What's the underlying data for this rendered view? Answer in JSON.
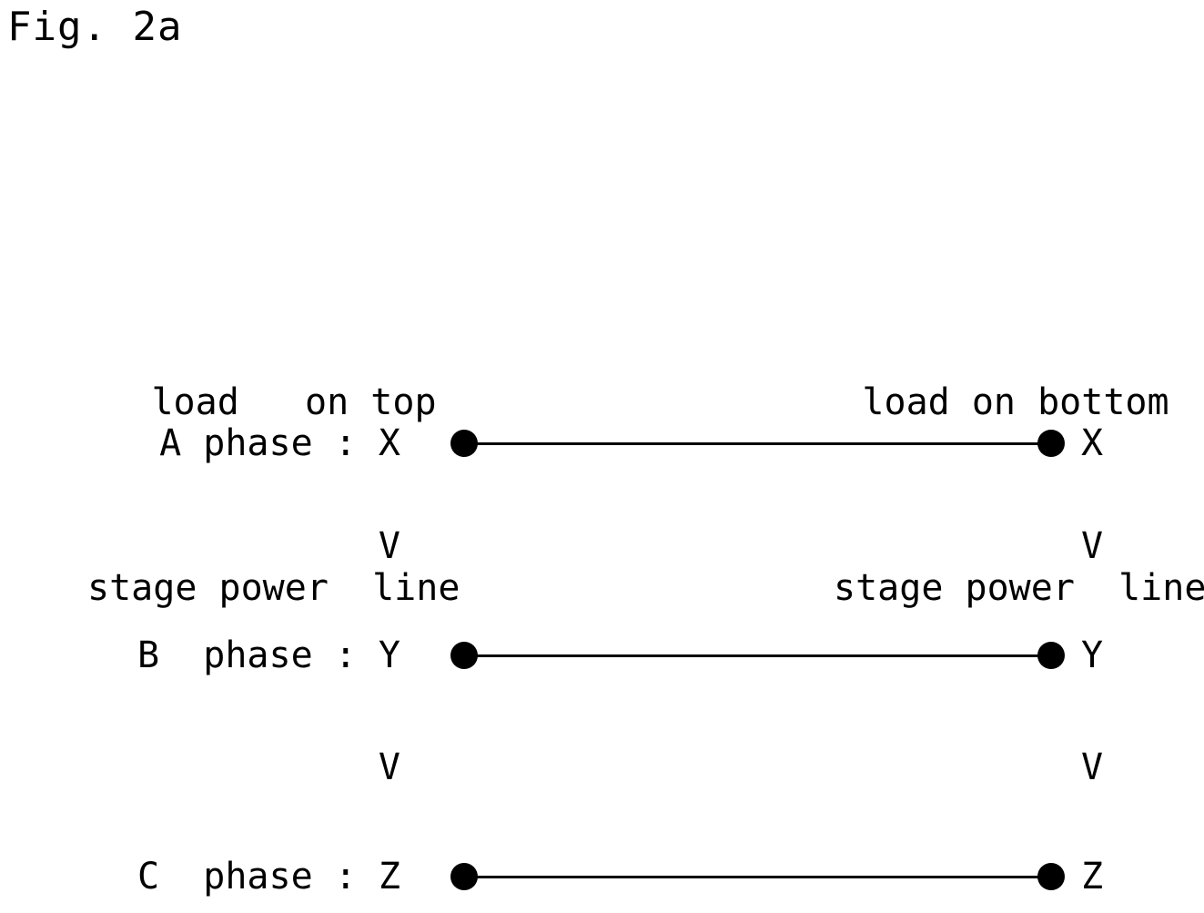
{
  "figure": {
    "caption": "Fig. 2a"
  },
  "headers": {
    "left": {
      "line1": "load   on top",
      "line2": "stage power  line"
    },
    "right": {
      "line1": "load on bottom",
      "line2": "stage power  line"
    }
  },
  "separator": {
    "mark": "V"
  },
  "rows": [
    {
      "label": "A phase :",
      "left_terminal": "X",
      "right_terminal": "X",
      "connected": true
    },
    {
      "label": "B  phase :",
      "left_terminal": "Y",
      "right_terminal": "Y",
      "connected": true
    },
    {
      "label": "C  phase :",
      "left_terminal": "Z",
      "right_terminal": "Z",
      "connected": true
    }
  ],
  "style": {
    "ink_color": "#000000",
    "background_color": "#ffffff"
  },
  "chart_data": {
    "type": "diagram",
    "title": "Fig. 2a",
    "description": "Three-phase power line connection mapping between top stage power line and bottom stage power line",
    "columns": [
      "load   on top stage power  line",
      "load on bottom stage power  line"
    ],
    "connections": [
      {
        "phase": "A phase",
        "from": "X",
        "to": "X"
      },
      {
        "phase": "B  phase",
        "from": "Y",
        "to": "Y"
      },
      {
        "phase": "C  phase",
        "from": "Z",
        "to": "Z"
      }
    ],
    "separators": [
      "V",
      "V"
    ]
  }
}
